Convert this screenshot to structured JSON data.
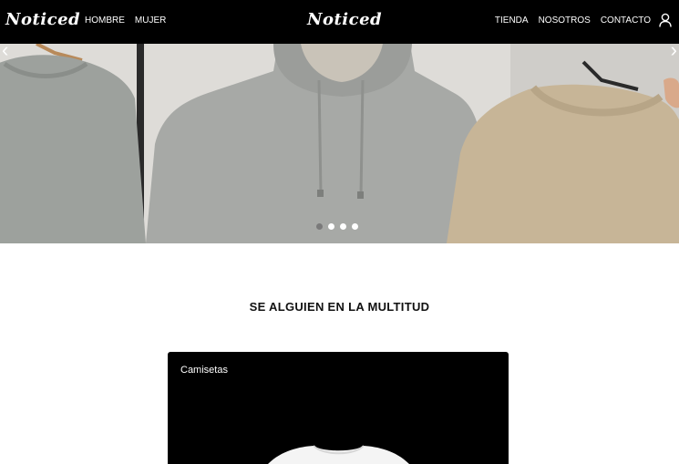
{
  "header": {
    "logo_left": "Noticed",
    "logo_center": "Noticed",
    "nav_left": [
      "HOMBRE",
      "MUJER"
    ],
    "nav_right": [
      "TIENDA",
      "NOSOTROS",
      "CONTACTO"
    ],
    "user_icon": "user-icon"
  },
  "hero": {
    "arrow_left": "‹",
    "arrow_right": "›",
    "slides_count": 4,
    "active_slide": 1
  },
  "tagline": "SE ALGUIEN EN LA MULTITUD",
  "categories": [
    {
      "label": "Camisetas"
    }
  ],
  "colors": {
    "header_bg": "#000000",
    "page_bg": "#ffffff",
    "card_bg": "#000000"
  }
}
